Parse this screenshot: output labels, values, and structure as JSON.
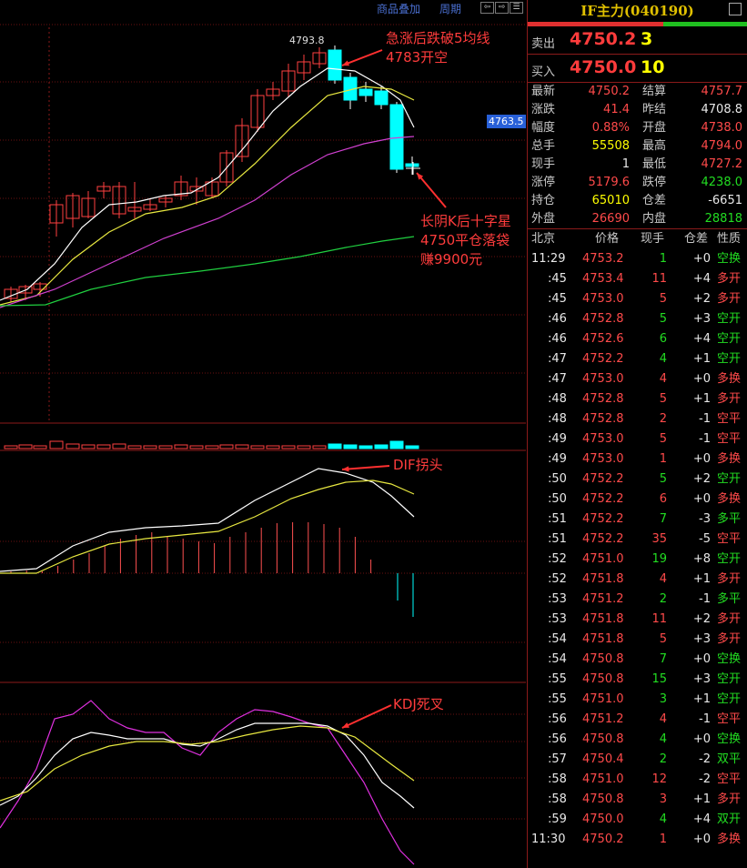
{
  "toolbar": {
    "overlay": "商品叠加",
    "period": "周期"
  },
  "annotations": {
    "a1_l1": "急涨后跌破5均线",
    "a1_l2": "4783开空",
    "a2_l1": "长阴K后十字星",
    "a2_l2": "4750平仓落袋",
    "a2_l3": "赚9900元",
    "a3": "DIF拐头",
    "a4": "KDJ死叉"
  },
  "chart": {
    "high_label": "4793.8",
    "price_tag": "4763.5"
  },
  "panel": {
    "title": "IF主力(040190)",
    "sell": {
      "label": "卖出",
      "price": "4750.2",
      "vol": "3"
    },
    "buy": {
      "label": "买入",
      "price": "4750.0",
      "vol": "10"
    },
    "stats": [
      {
        "k": "最新",
        "v": "4750.2",
        "c": "red",
        "k2": "结算",
        "v2": "4757.7",
        "c2": "red"
      },
      {
        "k": "涨跌",
        "v": "41.4",
        "c": "red",
        "k2": "昨结",
        "v2": "4708.8",
        "c2": "wht"
      },
      {
        "k": "幅度",
        "v": "0.88%",
        "c": "red",
        "k2": "开盘",
        "v2": "4738.0",
        "c2": "red"
      },
      {
        "k": "总手",
        "v": "55508",
        "c": "yel",
        "k2": "最高",
        "v2": "4794.0",
        "c2": "red"
      },
      {
        "k": "现手",
        "v": "1",
        "c": "wht",
        "k2": "最低",
        "v2": "4727.2",
        "c2": "red"
      },
      {
        "k": "涨停",
        "v": "5179.6",
        "c": "red",
        "k2": "跌停",
        "v2": "4238.0",
        "c2": "green"
      },
      {
        "k": "持仓",
        "v": "65010",
        "c": "yel",
        "k2": "仓差",
        "v2": "-6651",
        "c2": "wht"
      },
      {
        "k": "外盘",
        "v": "26690",
        "c": "red",
        "k2": "内盘",
        "v2": "28818",
        "c2": "green"
      }
    ],
    "ticks_head": {
      "time": "北京",
      "price": "价格",
      "vol": "现手",
      "oi": "仓差",
      "nature": "性质"
    },
    "ticks": [
      {
        "t": "11:29",
        "p": "4753.2",
        "v": "1",
        "o": "+0",
        "n": "空换",
        "nc": "green"
      },
      {
        "t": ":45",
        "p": "4753.4",
        "v": "11",
        "o": "+4",
        "n": "多开",
        "nc": "red"
      },
      {
        "t": ":45",
        "p": "4753.0",
        "v": "5",
        "o": "+2",
        "n": "多开",
        "nc": "red"
      },
      {
        "t": ":46",
        "p": "4752.8",
        "v": "5",
        "o": "+3",
        "n": "空开",
        "nc": "green"
      },
      {
        "t": ":46",
        "p": "4752.6",
        "v": "6",
        "o": "+4",
        "n": "空开",
        "nc": "green"
      },
      {
        "t": ":47",
        "p": "4752.2",
        "v": "4",
        "o": "+1",
        "n": "空开",
        "nc": "green"
      },
      {
        "t": ":47",
        "p": "4753.0",
        "v": "4",
        "o": "+0",
        "n": "多换",
        "nc": "red"
      },
      {
        "t": ":48",
        "p": "4752.8",
        "v": "5",
        "o": "+1",
        "n": "多开",
        "nc": "red"
      },
      {
        "t": ":48",
        "p": "4752.8",
        "v": "2",
        "o": "-1",
        "n": "空平",
        "nc": "red"
      },
      {
        "t": ":49",
        "p": "4753.0",
        "v": "5",
        "o": "-1",
        "n": "空平",
        "nc": "red"
      },
      {
        "t": ":49",
        "p": "4753.0",
        "v": "1",
        "o": "+0",
        "n": "多换",
        "nc": "red"
      },
      {
        "t": ":50",
        "p": "4752.2",
        "v": "5",
        "o": "+2",
        "n": "空开",
        "nc": "green"
      },
      {
        "t": ":50",
        "p": "4752.2",
        "v": "6",
        "o": "+0",
        "n": "多换",
        "nc": "red"
      },
      {
        "t": ":51",
        "p": "4752.2",
        "v": "7",
        "o": "-3",
        "n": "多平",
        "nc": "green"
      },
      {
        "t": ":51",
        "p": "4752.2",
        "v": "35",
        "o": "-5",
        "n": "空平",
        "nc": "red"
      },
      {
        "t": ":52",
        "p": "4751.0",
        "v": "19",
        "o": "+8",
        "n": "空开",
        "nc": "green"
      },
      {
        "t": ":52",
        "p": "4751.8",
        "v": "4",
        "o": "+1",
        "n": "多开",
        "nc": "red"
      },
      {
        "t": ":53",
        "p": "4751.2",
        "v": "2",
        "o": "-1",
        "n": "多平",
        "nc": "green"
      },
      {
        "t": ":53",
        "p": "4751.8",
        "v": "11",
        "o": "+2",
        "n": "多开",
        "nc": "red"
      },
      {
        "t": ":54",
        "p": "4751.8",
        "v": "5",
        "o": "+3",
        "n": "多开",
        "nc": "red"
      },
      {
        "t": ":54",
        "p": "4750.8",
        "v": "7",
        "o": "+0",
        "n": "空换",
        "nc": "green"
      },
      {
        "t": ":55",
        "p": "4750.8",
        "v": "15",
        "o": "+3",
        "n": "空开",
        "nc": "green"
      },
      {
        "t": ":55",
        "p": "4751.0",
        "v": "3",
        "o": "+1",
        "n": "空开",
        "nc": "green"
      },
      {
        "t": ":56",
        "p": "4751.2",
        "v": "4",
        "o": "-1",
        "n": "空平",
        "nc": "red"
      },
      {
        "t": ":56",
        "p": "4750.8",
        "v": "4",
        "o": "+0",
        "n": "空换",
        "nc": "green"
      },
      {
        "t": ":57",
        "p": "4750.4",
        "v": "2",
        "o": "-2",
        "n": "双平",
        "nc": "green"
      },
      {
        "t": ":58",
        "p": "4751.0",
        "v": "12",
        "o": "-2",
        "n": "空平",
        "nc": "red"
      },
      {
        "t": ":58",
        "p": "4750.8",
        "v": "3",
        "o": "+1",
        "n": "多开",
        "nc": "red"
      },
      {
        "t": ":59",
        "p": "4750.0",
        "v": "4",
        "o": "+4",
        "n": "双开",
        "nc": "green"
      },
      {
        "t": "11:30",
        "p": "4750.2",
        "v": "1",
        "o": "+0",
        "n": "多换",
        "nc": "red"
      }
    ]
  }
}
